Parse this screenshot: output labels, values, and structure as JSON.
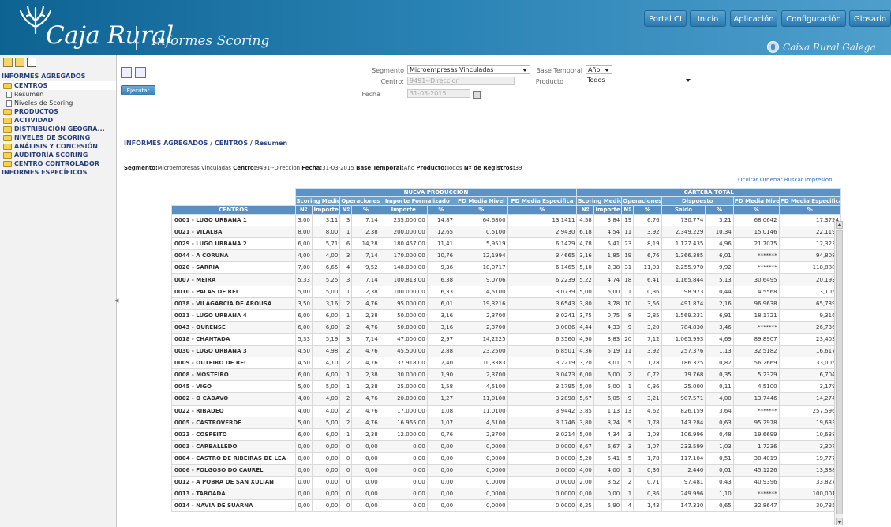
{
  "header": {
    "logo_text": "Caja Rural",
    "app_title": "Informes Scoring",
    "bank_name": "Caixa Rural Galega",
    "nav": [
      "Portal CI",
      "Inicio",
      "Aplicación",
      "Configuración",
      "Glosario"
    ]
  },
  "sidebar": {
    "section_aggregated": "INFORMES AGREGADOS",
    "items": [
      {
        "type": "folder",
        "label": "CENTROS",
        "active": true
      },
      {
        "type": "leaf",
        "label": "Resumen"
      },
      {
        "type": "leaf",
        "label": "Niveles de Scoring"
      },
      {
        "type": "folder",
        "label": "PRODUCTOS"
      },
      {
        "type": "folder",
        "label": "ACTIVIDAD"
      },
      {
        "type": "folder",
        "label": "DISTRIBUCIÓN GEOGRÁ..."
      },
      {
        "type": "folder",
        "label": "NIVELES DE SCORING"
      },
      {
        "type": "folder",
        "label": "ANÁLISIS Y CONCESIÓN"
      },
      {
        "type": "folder",
        "label": "AUDITORÍA SCORING"
      },
      {
        "type": "folder",
        "label": "CENTRO CONTROLADOR"
      }
    ],
    "section_specific": "INFORMES ESPECÍFICOS"
  },
  "form": {
    "execute_label": "Ejecutar",
    "segmento_label": "Segmento",
    "segmento_value": "Microempresas Vinculadas",
    "base_temporal_label": "Base Temporal",
    "base_temporal_value": "Año",
    "centro_label": "Centro:",
    "centro_value": "9491--Direccion",
    "producto_label": "Producto",
    "producto_value": "Todos",
    "fecha_label": "Fecha",
    "fecha_value": "31-03-2015"
  },
  "breadcrumb": "INFORMES AGREGADOS / CENTROS / Resumen",
  "summary": {
    "segmento_k": "Segmento:",
    "segmento_v": "Microempresas Vinculadas",
    "centro_k": "Centro:",
    "centro_v": "9491--Direccion",
    "fecha_k": "Fecha:",
    "fecha_v": "31-03-2015",
    "base_k": "Base Temporal:",
    "base_v": "Año",
    "producto_k": "Producto:",
    "producto_v": "Todos",
    "registros_k": "Nº de Registros:",
    "registros_v": "39"
  },
  "table_actions": [
    "Ocultar",
    "Ordenar",
    "Buscar",
    "Impresion"
  ],
  "table": {
    "groups": [
      "NUEVA PRODUCCIÓN",
      "CARTERA TOTAL"
    ],
    "sub_np": [
      "Scoring Medio",
      "Operaciones",
      "Importe Formalizado",
      "PD Media Nivel",
      "PD Media Especifica"
    ],
    "sub_ct": [
      "Scoring Medio",
      "Operaciones",
      "Dispuesto",
      "PD Media Nivel",
      "PD Media Especifica"
    ],
    "columns": [
      "CENTROS",
      "Nº",
      "Importe",
      "Nº",
      "%",
      "Importe",
      "%",
      "%",
      "%",
      "Nº",
      "Importe",
      "Nº",
      "%",
      "Saldo",
      "%",
      "%",
      "%"
    ],
    "rows": [
      [
        "0001 - LUGO URBANA 1",
        "3,00",
        "3,11",
        "3",
        "7,14",
        "235.000,00",
        "14,87",
        "64,6800",
        "13,1411",
        "4,58",
        "3,84",
        "19",
        "6,76",
        "730.774",
        "3,21",
        "68,0642",
        "17,3724"
      ],
      [
        "0021 - VILALBA",
        "8,00",
        "8,00",
        "1",
        "2,38",
        "200.000,00",
        "12,65",
        "0,5100",
        "2,9430",
        "6,18",
        "4,54",
        "11",
        "3,92",
        "2.349.229",
        "10,34",
        "15,0146",
        "22,1194"
      ],
      [
        "0029 - LUGO URBANA 2",
        "6,00",
        "5,71",
        "6",
        "14,28",
        "180.457,00",
        "11,41",
        "5,9519",
        "6,1429",
        "4,78",
        "5,41",
        "23",
        "8,19",
        "1.127.435",
        "4,96",
        "21,7075",
        "12,3239"
      ],
      [
        "0044 - A CORUÑA",
        "4,00",
        "4,00",
        "3",
        "7,14",
        "170.000,00",
        "10,76",
        "12,1994",
        "3,4665",
        "3,16",
        "1,85",
        "19",
        "6,76",
        "1.366.385",
        "6,01",
        "*******",
        "94,8081"
      ],
      [
        "0020 - SARRIA",
        "7,00",
        "6,65",
        "4",
        "9,52",
        "148.000,00",
        "9,36",
        "10,0717",
        "6,1465",
        "5,10",
        "2,38",
        "31",
        "11,03",
        "2.255.970",
        "9,92",
        "*******",
        "118,8887"
      ],
      [
        "0007 - MEIRA",
        "5,33",
        "5,25",
        "3",
        "7,14",
        "100.813,00",
        "6,38",
        "9,0706",
        "6,2239",
        "5,22",
        "4,74",
        "18",
        "6,41",
        "1.165.844",
        "5,13",
        "30,6495",
        "20,1931"
      ],
      [
        "0010 - PALAS DE REI",
        "5,00",
        "5,00",
        "1",
        "2,38",
        "100.000,00",
        "6,33",
        "4,5100",
        "3,0739",
        "5,00",
        "5,00",
        "1",
        "0,36",
        "98.973",
        "0,44",
        "4,5568",
        "3,1058"
      ],
      [
        "0038 - VILAGARCIA DE AROUSA",
        "3,50",
        "3,16",
        "2",
        "4,76",
        "95.000,00",
        "6,01",
        "19,3216",
        "3,6543",
        "3,80",
        "3,78",
        "10",
        "3,56",
        "491.874",
        "2,16",
        "96,9638",
        "65,7399"
      ],
      [
        "0031 - LUGO URBANA 4",
        "6,00",
        "6,00",
        "1",
        "2,38",
        "50.000,00",
        "3,16",
        "2,3700",
        "3,0241",
        "3,75",
        "0,75",
        "8",
        "2,85",
        "1.569.231",
        "6,91",
        "18,1721",
        "9,3161"
      ],
      [
        "0043 - OURENSE",
        "6,00",
        "6,00",
        "2",
        "4,76",
        "50.000,00",
        "3,16",
        "2,3700",
        "3,0086",
        "4,44",
        "4,33",
        "9",
        "3,20",
        "784.830",
        "3,46",
        "*******",
        "26,7369"
      ],
      [
        "0018 - CHANTADA",
        "5,33",
        "5,19",
        "3",
        "7,14",
        "47.000,00",
        "2,97",
        "14,2225",
        "6,3560",
        "4,90",
        "3,83",
        "20",
        "7,12",
        "1.065.993",
        "4,69",
        "89,8907",
        "23,4032"
      ],
      [
        "0030 - LUGO URBANA 3",
        "4,50",
        "4,98",
        "2",
        "4,76",
        "45.500,00",
        "2,88",
        "23,2500",
        "6,8501",
        "4,36",
        "5,19",
        "11",
        "3,92",
        "257.376",
        "1,13",
        "32,5182",
        "16,6170"
      ],
      [
        "0009 - OUTEIRO DE REI",
        "4,50",
        "4,10",
        "2",
        "4,76",
        "37.918,00",
        "2,40",
        "10,3383",
        "3,2219",
        "3,20",
        "3,01",
        "5",
        "1,78",
        "186.325",
        "0,82",
        "56,2669",
        "33,0057"
      ],
      [
        "0008 - MOSTEIRO",
        "6,00",
        "6,00",
        "1",
        "2,38",
        "30.000,00",
        "1,90",
        "2,3700",
        "3,0473",
        "6,00",
        "6,00",
        "2",
        "0,72",
        "79.768",
        "0,35",
        "5,2329",
        "6,7043"
      ],
      [
        "0045 - VIGO",
        "5,00",
        "5,00",
        "1",
        "2,38",
        "25.000,00",
        "1,58",
        "4,5100",
        "3,1795",
        "5,00",
        "5,00",
        "1",
        "0,36",
        "25.000",
        "0,11",
        "4,5100",
        "3,1795"
      ],
      [
        "0002 - O CADAVO",
        "4,00",
        "4,00",
        "2",
        "4,76",
        "20.000,00",
        "1,27",
        "11,0100",
        "3,2898",
        "5,67",
        "6,05",
        "9",
        "3,21",
        "907.571",
        "4,00",
        "13,7446",
        "14,2745"
      ],
      [
        "0022 - RIBADEO",
        "4,00",
        "4,00",
        "2",
        "4,76",
        "17.000,00",
        "1,08",
        "11,0100",
        "3,9442",
        "3,85",
        "1,13",
        "13",
        "4,62",
        "826.159",
        "3,64",
        "*******",
        "257,5967"
      ],
      [
        "0005 - CASTROVERDE",
        "5,00",
        "5,00",
        "2",
        "4,76",
        "16.965,00",
        "1,07",
        "4,5100",
        "3,1746",
        "3,80",
        "3,24",
        "5",
        "1,78",
        "143.284",
        "0,63",
        "95,2978",
        "19,6334"
      ],
      [
        "0023 - COSPEITO",
        "6,00",
        "6,00",
        "1",
        "2,38",
        "12.000,00",
        "0,76",
        "2,3700",
        "3,0214",
        "5,00",
        "4,34",
        "3",
        "1,08",
        "106.996",
        "0,48",
        "19,6699",
        "10,6381"
      ],
      [
        "0003 - CARBALLEDO",
        "0,00",
        "0,00",
        "0",
        "0,00",
        "0,00",
        "0,00",
        "0,0000",
        "0,0000",
        "6,67",
        "6,67",
        "3",
        "1,07",
        "233.599",
        "1,03",
        "1,7236",
        "3,3073"
      ],
      [
        "0004 - CASTRO DE RIBEIRAS DE LEA",
        "0,00",
        "0,00",
        "0",
        "0,00",
        "0,00",
        "0,00",
        "0,0000",
        "0,0000",
        "5,20",
        "5,41",
        "5",
        "1,78",
        "117.104",
        "0,51",
        "30,4019",
        "19,7776"
      ],
      [
        "0006 - FOLGOSO DO CAUREL",
        "0,00",
        "0,00",
        "0",
        "0,00",
        "0,00",
        "0,00",
        "0,0000",
        "0,0000",
        "4,00",
        "4,00",
        "1",
        "0,36",
        "2.440",
        "0,01",
        "45,1226",
        "13,3888"
      ],
      [
        "0012 - A POBRA DE SAN XULIAN",
        "0,00",
        "0,00",
        "0",
        "0,00",
        "0,00",
        "0,00",
        "0,0000",
        "0,0000",
        "2,00",
        "3,52",
        "2",
        "0,71",
        "97.481",
        "0,43",
        "40,9396",
        "33,8279"
      ],
      [
        "0013 - TABOADA",
        "0,00",
        "0,00",
        "0",
        "0,00",
        "0,00",
        "0,00",
        "0,0000",
        "0,0000",
        "0,00",
        "0,00",
        "1",
        "0,36",
        "249.996",
        "1,10",
        "*******",
        "100,0013"
      ],
      [
        "0014 - NAVIA DE SUARNA",
        "0,00",
        "0,00",
        "0",
        "0,00",
        "0,00",
        "0,00",
        "0,0000",
        "0,0000",
        "6,25",
        "5,90",
        "4",
        "1,43",
        "147.330",
        "0,65",
        "32,8647",
        "30,7357"
      ]
    ]
  },
  "colors": {
    "header_start": "#0d6392",
    "header_end": "#4f9fcc",
    "table_header": "#5a8fbf",
    "link": "#2e6fbf"
  }
}
